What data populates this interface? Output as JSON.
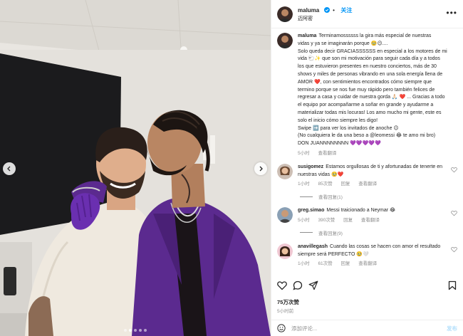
{
  "post": {
    "username": "maluma",
    "follow_label": "关注",
    "subtitle": "迈阿密",
    "more_label": "•••"
  },
  "caption": {
    "username": "maluma",
    "lines": [
      "Terminamossssss la gira más especial de nuestras",
      "vidas y ya se imaginarán porque 🥹😉....",
      "Solo queda decir GRACIASSSSSS en especial a los motores de mi",
      "vida 🐑✨ que son mi motivación para seguir cada día y a todos",
      "los que estuvieron presentes en nuestro conciertos, más de 30",
      "shows y miles de personas vibrando en una sola energía llena de",
      "AMOR ❤️, con sentimientos encontrados cómo siempre que",
      "termino porque se nos fue muy rápido pero también felices de",
      "regresar a casa y cuidar de nuestra gorda 🙏🏻 ❤️ ... Gracias a todo",
      "el equipo por acompañarme a soñar en grande y ayudarme a",
      "materializar todas mis locuras! Los amo mucho mi gente, este es",
      "solo el inicio cómo siempre les digo!",
      "Swipe ➡️ para ver los invitados de anoche 😉",
      "(No cualquiera le da una beso a @leomessi 😂 te amo mi bro)",
      "DON JUANNNNNNNN 💜💜💜💜💜"
    ],
    "time": "5小时",
    "translate": "查看翻译"
  },
  "comments": [
    {
      "username": "susigomez",
      "text": "Estamos orgullosas de ti y afortunadas de tenerte en nuestras vidas 🥹❤️",
      "time": "1小时",
      "likes": "85次赞",
      "reply": "回复",
      "translate": "查看翻译",
      "replies": "查看回复(1)"
    },
    {
      "username": "greg.simao",
      "text": "Messi traicionado a Neymar 😂",
      "time": "5小时",
      "likes": "390次赞",
      "reply": "回复",
      "translate": "查看翻译",
      "replies": "查看回复(9)"
    },
    {
      "username": "anavillegash",
      "text": "Cuando las cosas se hacen con amor el resultado siempre será PERFECTO 🥹🤍",
      "time": "1小时",
      "likes": "61次赞",
      "reply": "回复",
      "translate": "查看翻译"
    }
  ],
  "stats": {
    "likes": "75万次赞",
    "time": "5小时前"
  },
  "add_comment": {
    "placeholder": "添加评论...",
    "post_label": "发布"
  },
  "colors": {
    "accent": "#0095f6",
    "like_outline": "#262626",
    "suit": "#5b2a8f",
    "glove": "#6a2fb0"
  },
  "carousel": {
    "slide_count": 5,
    "active_index": 1
  }
}
